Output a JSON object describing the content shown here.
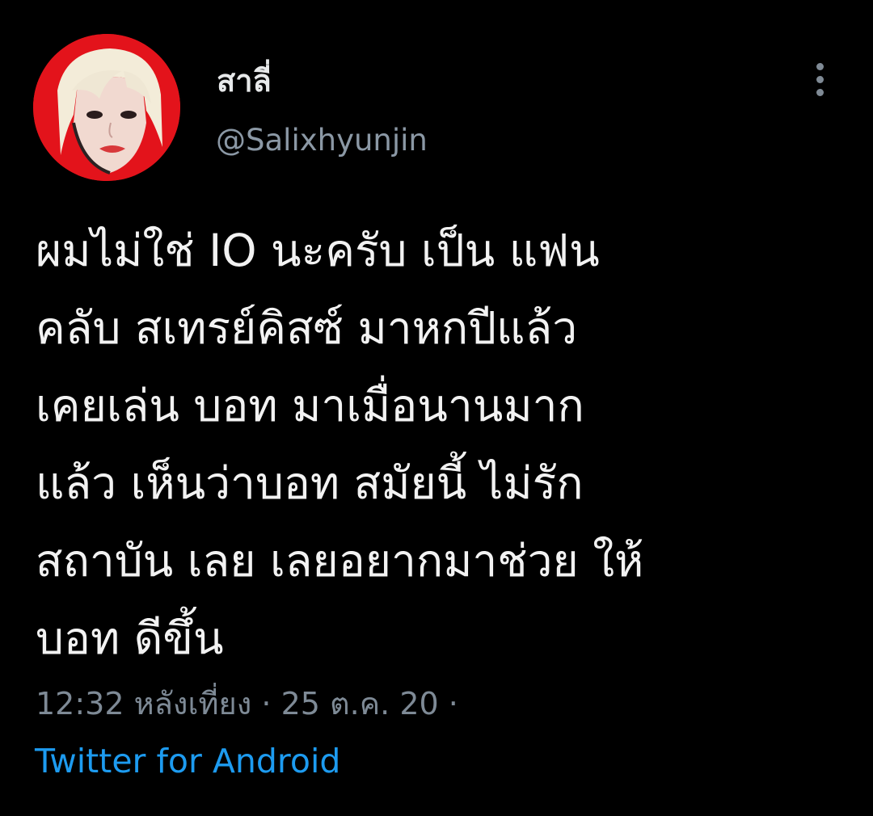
{
  "tweet": {
    "author": {
      "display_name": "สาลี่",
      "handle": "@Salixhyunjin"
    },
    "more_icon": "more-vertical-icon",
    "text": "ผมไม่ใช่ IO นะครับ เป็น แฟน\nคลับ สเทรย์คิสซ์ มาหกปีแล้ว\nเคยเล่น บอท มาเมื่อนานมาก\nแล้ว เห็นว่าบอท สมัยนี้ ไม่รัก\nสถาบัน เลย เลยอยากมาช่วย ให้\nบอท ดีขึ้น",
    "meta": "12:32 หลังเที่ยง · 25 ต.ค. 20 ·",
    "source": "Twitter for Android"
  },
  "colors": {
    "background": "#000000",
    "name": "#e7e9ea",
    "secondary_text": "#8b98a5",
    "link": "#1d9bf0",
    "avatar_bg": "#e3131b"
  }
}
